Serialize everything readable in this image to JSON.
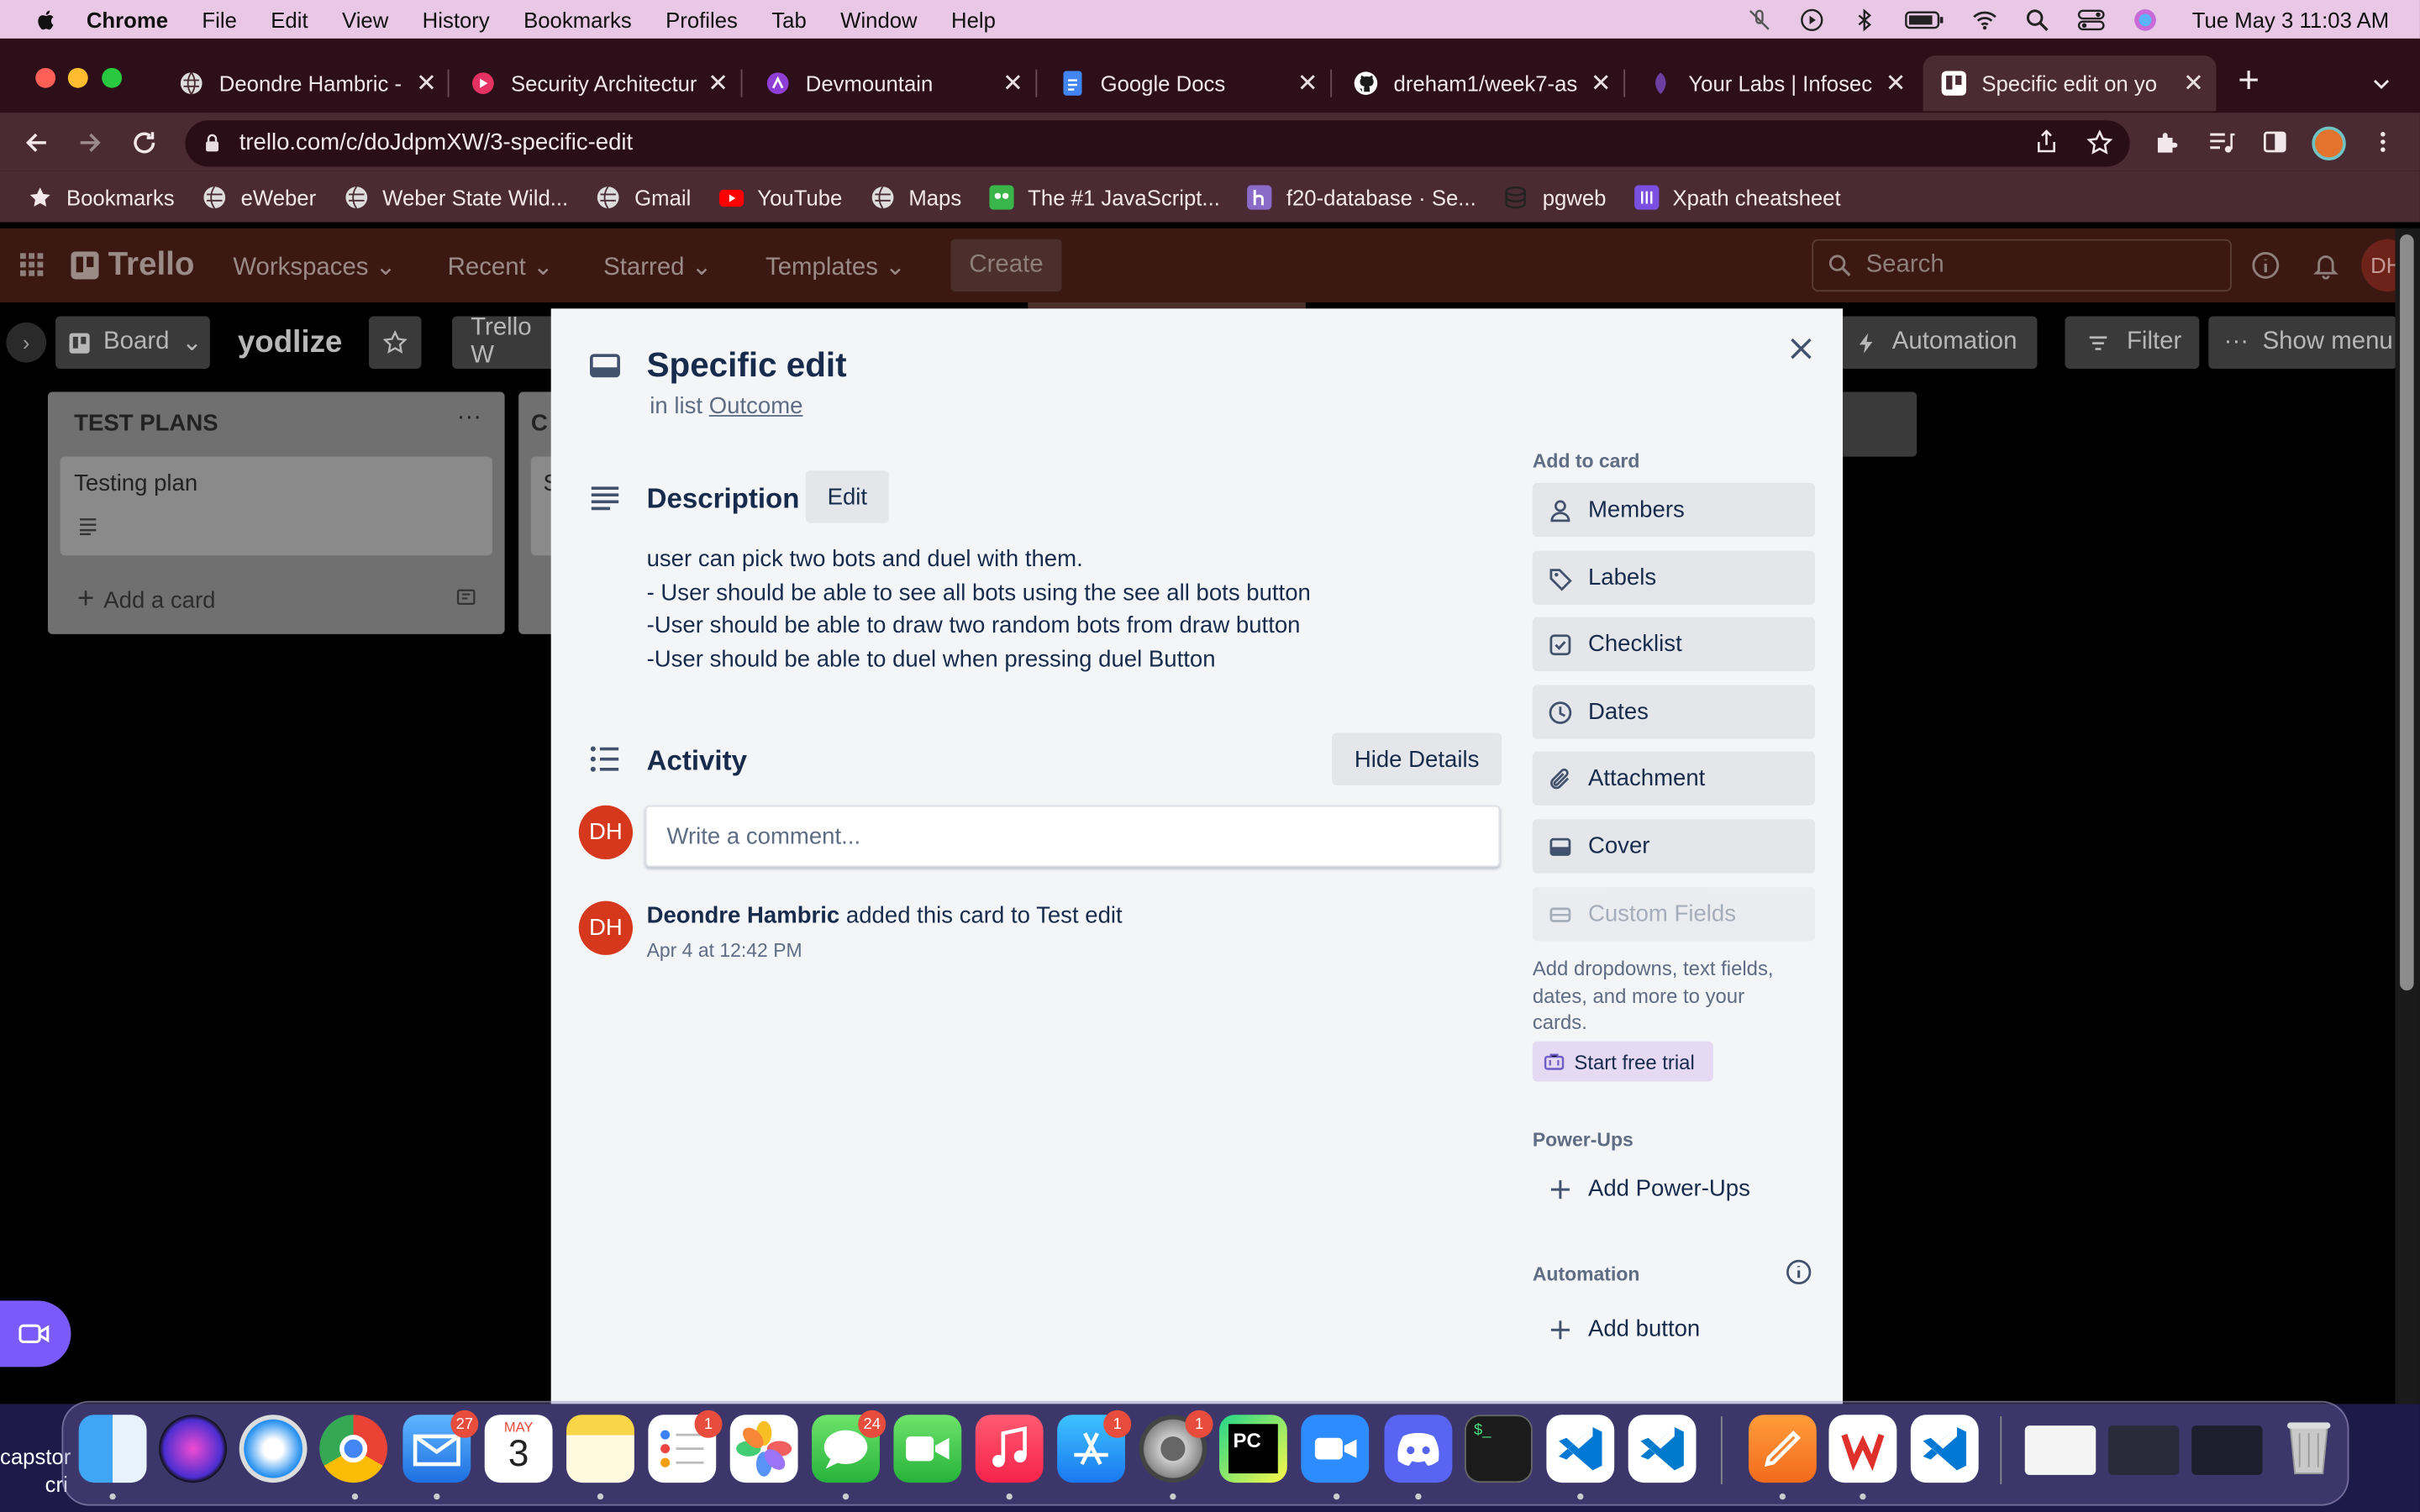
{
  "menubar": {
    "app": "Chrome",
    "items": [
      "File",
      "Edit",
      "View",
      "History",
      "Bookmarks",
      "Profiles",
      "Tab",
      "Window",
      "Help"
    ],
    "clock": "Tue May 3  11:03 AM"
  },
  "tabs": [
    {
      "label": "Deondre Hambric -",
      "active": false
    },
    {
      "label": "Security Architectur",
      "active": false
    },
    {
      "label": "Devmountain",
      "active": false
    },
    {
      "label": "Google Docs",
      "active": false
    },
    {
      "label": "dreham1/week7-as",
      "active": false
    },
    {
      "label": "Your Labs | Infosec",
      "active": false
    },
    {
      "label": "Specific edit on yo",
      "active": true
    }
  ],
  "address": {
    "url": "trello.com/c/doJdpmXW/3-specific-edit"
  },
  "bookmarks": [
    "Bookmarks",
    "eWeber",
    "Weber State Wild...",
    "Gmail",
    "YouTube",
    "Maps",
    "The #1 JavaScript...",
    "f20-database · Se...",
    "pgweb",
    "Xpath cheatsheet"
  ],
  "trello": {
    "logo": "Trello",
    "nav": [
      "Workspaces",
      "Recent",
      "Starred",
      "Templates"
    ],
    "create": "Create",
    "search_placeholder": "Search",
    "avatar_initials": "DH",
    "board_view": "Board",
    "board_name": "yodlize",
    "workspace_partial": "Trello W",
    "automation": "Automation",
    "filter": "Filter",
    "show_menu": "Show menu",
    "list_title": "TEST PLANS",
    "list2_partial": "C",
    "card_title": "Testing plan",
    "card2_partial": "S",
    "add_card": "Add a card"
  },
  "modal": {
    "title": "Specific edit",
    "in_list_prefix": "in list",
    "list_name": "Outcome",
    "description_heading": "Description",
    "edit_label": "Edit",
    "description_lines": [
      "user can pick two bots and duel with them.",
      "- User should be able to see all bots using the see all bots button",
      "-User should be able to draw two random bots from draw button",
      "-User should be able to duel when pressing duel Button"
    ],
    "activity_heading": "Activity",
    "hide_details": "Hide Details",
    "comment_placeholder": "Write a comment...",
    "avatar_initials": "DH",
    "activity_user": "Deondre Hambric",
    "activity_text": "added this card to Test edit",
    "activity_time": "Apr 4 at 12:42 PM",
    "sidebar": {
      "add_to_card": "Add to card",
      "members": "Members",
      "labels": "Labels",
      "checklist": "Checklist",
      "dates": "Dates",
      "attachment": "Attachment",
      "cover": "Cover",
      "custom_fields": "Custom Fields",
      "custom_fields_help_1": "Add dropdowns, text fields,",
      "custom_fields_help_2": "dates, and more to your",
      "custom_fields_help_3": "cards.",
      "start_trial": "Start free trial",
      "powerups": "Power-Ups",
      "add_powerups": "Add Power-Ups",
      "automation": "Automation",
      "add_button": "Add button"
    }
  },
  "dock": {
    "mail_badge": "27",
    "calendar_month": "MAY",
    "calendar_day": "3",
    "reminders_badge": "1",
    "messages_badge": "24",
    "appstore_badge": "1",
    "settings_badge": "1",
    "left_text_1": "capstor",
    "left_text_2": "cri"
  }
}
